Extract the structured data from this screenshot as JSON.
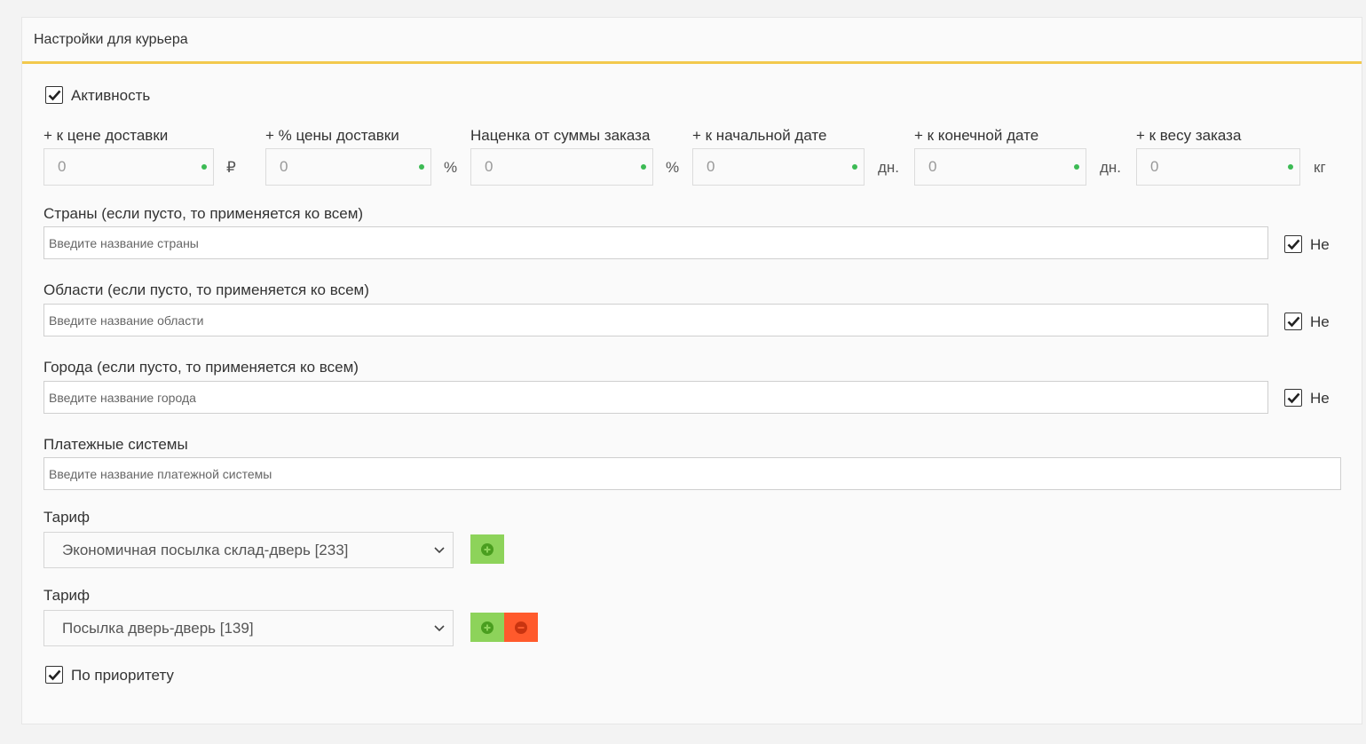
{
  "header": {
    "title": "Настройки для курьера"
  },
  "activity": {
    "label": "Активность",
    "checked": true
  },
  "numeric_fields": [
    {
      "label": "+ к цене доставки",
      "value": "0",
      "unit": "₽"
    },
    {
      "label": "+ % цены доставки",
      "value": "0",
      "unit": "%"
    },
    {
      "label": "Наценка от суммы заказа",
      "value": "0",
      "unit": "%"
    },
    {
      "label": "+ к начальной дате",
      "value": "0",
      "unit": "дн."
    },
    {
      "label": "+ к конечной дате",
      "value": "0",
      "unit": "дн."
    },
    {
      "label": "+ к весу заказа",
      "value": "0",
      "unit": "кг"
    }
  ],
  "countries": {
    "label": "Страны (если пусто, то применяется ко всем)",
    "placeholder": "Введите название страны",
    "negate_label": "Не",
    "negate_checked": true
  },
  "regions": {
    "label": "Области (если пусто, то применяется ко всем)",
    "placeholder": "Введите название области",
    "negate_label": "Не",
    "negate_checked": true
  },
  "cities": {
    "label": "Города (если пусто, то применяется ко всем)",
    "placeholder": "Введите название города",
    "negate_label": "Не",
    "negate_checked": true
  },
  "payment_systems": {
    "label": "Платежные системы",
    "placeholder": "Введите название платежной системы"
  },
  "tariffs": [
    {
      "label": "Тариф",
      "selected": "Экономичная посылка склад-дверь [233]",
      "buttons": [
        "add-icon"
      ]
    },
    {
      "label": "Тариф",
      "selected": "Посылка дверь-дверь [139]",
      "buttons": [
        "add-icon",
        "remove-icon"
      ]
    }
  ],
  "priority": {
    "label": "По приоритету",
    "checked": true
  },
  "colors": {
    "accent": "#f2c94c",
    "add": "#8dd35a",
    "remove": "#ff5a2c",
    "dot": "#3cba54"
  }
}
